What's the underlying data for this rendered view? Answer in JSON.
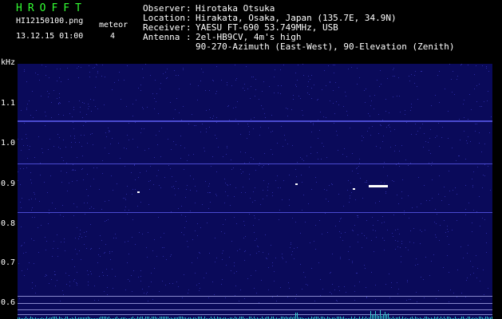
{
  "header": {
    "brand": "HROFFT",
    "filename": "HI12150100.png",
    "datetime": "13.12.15 01:00",
    "meteor_label": "meteor",
    "meteor_count": "4"
  },
  "station": {
    "observer_label": "Observer",
    "observer": "Hirotaka Otsuka",
    "location_label": "Location",
    "location": "Hirakata, Osaka, Japan (135.7E, 34.9N)",
    "receiver_label": "Receiver",
    "receiver": "YAESU FT-690 53.749MHz, USB",
    "antenna_label": "Antenna",
    "antenna_line1": "2el-HB9CV, 4m's high",
    "antenna_line2": "90-270-Azimuth (East-West), 90-Elevation (Zenith)"
  },
  "spectrogram": {
    "unit_label": "kHz",
    "y_ticks": [
      "1.1",
      "1.0",
      "0.9",
      "0.8",
      "0.7",
      "0.6"
    ],
    "time_ticks": [
      "0101",
      "0102",
      "0103",
      "0104",
      "0105",
      "0106",
      "0107",
      "0108",
      "0109",
      "0110"
    ],
    "colors": {
      "background": "#0a0a5a",
      "noise": "#2a2aa0",
      "hline": "#4a4ad0",
      "grid": "#8888cc",
      "echo": "#ffffff",
      "meter": "#33cccc"
    }
  }
}
